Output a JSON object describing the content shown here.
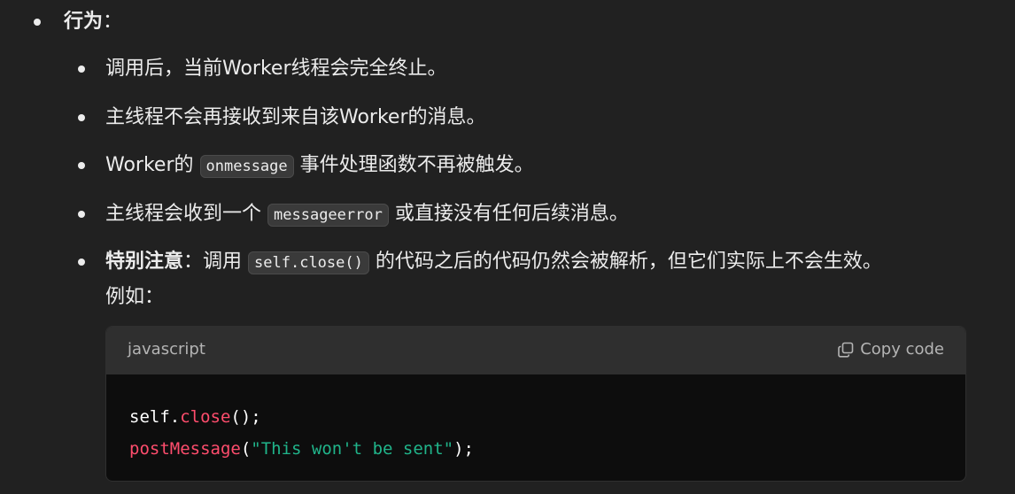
{
  "list": {
    "top": {
      "label": "行为",
      "suffix": "："
    },
    "items": [
      {
        "text": "调用后，当前Worker线程会完全终止。"
      },
      {
        "text": "主线程不会再接收到来自该Worker的消息。"
      },
      {
        "pre": "Worker的",
        "code": "onmessage",
        "post": "事件处理函数不再被触发。"
      },
      {
        "pre": "主线程会收到一个",
        "code": "messageerror",
        "post": "或直接没有任何后续消息。"
      },
      {
        "strong": "特别注意",
        "colon": "：调用",
        "code": "self.close()",
        "post": "的代码之后的代码仍然会被解析，但它们实际上不会生效。",
        "line2": "例如："
      }
    ]
  },
  "codeblock": {
    "language": "javascript",
    "copy_label": "Copy code",
    "copy_icon": "copy-icon",
    "lines": [
      {
        "t1": "self.",
        "t2": "close",
        "t3": "();"
      },
      {
        "t1": "postMessage",
        "t2": "(",
        "t3": "\"This won't be sent\"",
        "t4": ");"
      }
    ]
  },
  "colors": {
    "background": "#212121",
    "code_background": "#0d0d0d",
    "code_header": "#2f2f2f",
    "function": "#ff4d6d",
    "string": "#20b48a"
  }
}
